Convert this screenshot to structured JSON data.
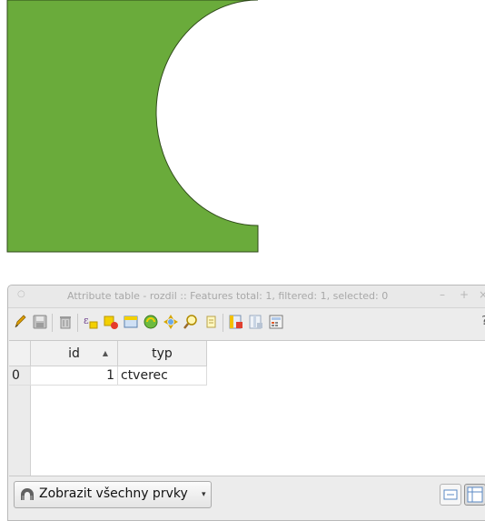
{
  "window": {
    "title": "Attribute table - rozdil :: Features total: 1, filtered: 1, selected: 0",
    "menu_glyph": "○",
    "minimize_glyph": "–",
    "maximize_glyph": "+",
    "close_glyph": "×"
  },
  "map": {
    "polygon_fill": "#6aab3b",
    "polygon_stroke": "#2f4a1a"
  },
  "toolbar": {
    "help_label": "?",
    "icons": [
      "pencil-icon",
      "save-icon",
      "delete-icon",
      "expression-select-icon",
      "deselect-icon",
      "move-selection-top-icon",
      "invert-selection-icon",
      "pan-to-selected-icon",
      "zoom-to-selected-icon",
      "copy-rows-icon",
      "new-field-icon",
      "delete-field-icon",
      "field-calculator-icon"
    ]
  },
  "table": {
    "columns": [
      {
        "label": "id",
        "sort_indicator": "▲"
      },
      {
        "label": "typ"
      }
    ],
    "rows": [
      {
        "row_header": "0",
        "id": "1",
        "typ": "ctverec"
      }
    ]
  },
  "bottom": {
    "filter_label": "Zobrazit všechny prvky",
    "filter_chevron": "▾"
  }
}
